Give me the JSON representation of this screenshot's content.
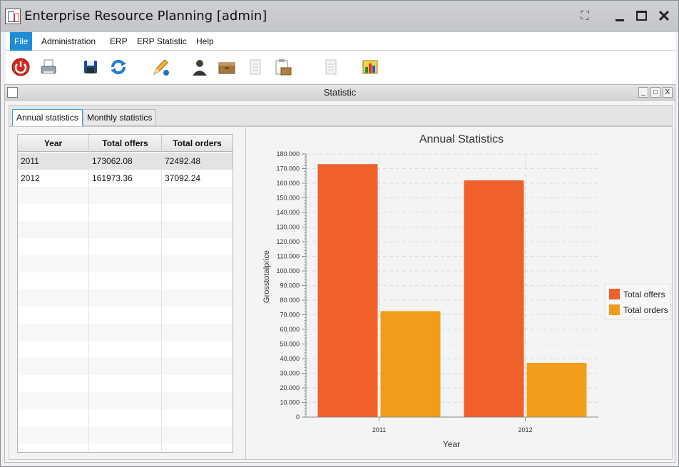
{
  "window": {
    "title": "Enterprise Resource Planning [admin]"
  },
  "menu": {
    "items": [
      "File",
      "Administration",
      "ERP",
      "ERP Statistic",
      "Help"
    ],
    "active": "File"
  },
  "toolbar": {
    "icons": [
      "power-icon",
      "printer-icon",
      "save-icon",
      "refresh-icon",
      "edit-pencil-icon",
      "user-icon",
      "box-icon",
      "document-icon",
      "clipboard-icon",
      "document-2-icon",
      "chart-icon"
    ]
  },
  "internal_frame": {
    "title": "Statistic",
    "buttons": [
      "_",
      "□",
      "X"
    ]
  },
  "tabs": [
    {
      "label": "Annual statistics",
      "active": true
    },
    {
      "label": "Monthly statistics",
      "active": false
    }
  ],
  "table": {
    "columns": [
      "Year",
      "Total offers",
      "Total orders"
    ],
    "rows": [
      [
        "2011",
        "173062.08",
        "72492.48"
      ],
      [
        "2012",
        "161973.36",
        "37092.24"
      ]
    ]
  },
  "colors": {
    "offers": "#f0602b",
    "orders": "#f39c1c",
    "accent": "#1f8dd6"
  },
  "chart_data": {
    "type": "bar",
    "title": "Annual Statistics",
    "xlabel": "Year",
    "ylabel": "Grosstotalprice",
    "categories": [
      "2011",
      "2012"
    ],
    "series": [
      {
        "name": "Total offers",
        "values": [
          173062.08,
          161973.36
        ]
      },
      {
        "name": "Total orders",
        "values": [
          72492.48,
          37092.24
        ]
      }
    ],
    "ylim": [
      0,
      180000
    ],
    "ytick_labels": [
      "0",
      "10.000",
      "20.000",
      "30.000",
      "40.000",
      "50.000",
      "60.000",
      "70.000",
      "80.000",
      "90.000",
      "100.000",
      "110.000",
      "120.000",
      "130.000",
      "140.000",
      "150.000",
      "160.000",
      "170.000",
      "180.000"
    ],
    "grid": true,
    "legend": "right"
  }
}
